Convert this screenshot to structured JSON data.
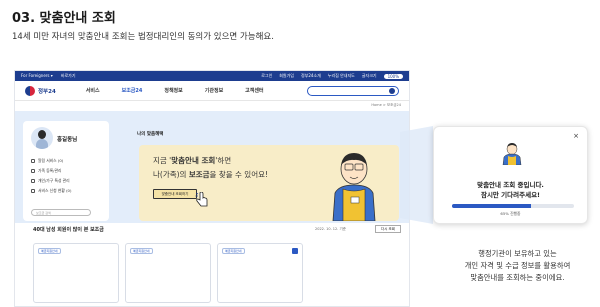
{
  "heading": "03. 맞춤안내 조회",
  "description": "14세 미만 자녀의 맞춤안내 조회는 법정대리인의 동의가 있으면 가능해요.",
  "site": {
    "topbar_left": [
      "For Foreigners ▾",
      "바로가기"
    ],
    "topbar_right": [
      "로그인",
      "회원가입",
      "정부24소개",
      "누리집 안내지도",
      "글자크기"
    ],
    "logo_text": "정부24",
    "nav": [
      "서비스",
      "보조금24",
      "정책정보",
      "기관정보",
      "고객센터"
    ],
    "active_nav_index": 1,
    "breadcrumb": "Home > 보조금24"
  },
  "profile": {
    "name": "홍길동님",
    "menu": [
      "알림 서비스 (0)",
      "가족 등록/관리",
      "개인/가구 특성 관리",
      "서비스 신청 현황 (0)"
    ],
    "search_placeholder": "보조금 검색"
  },
  "main": {
    "section_title": "나의 맞춤혜택",
    "banner_line1_pre": "지금 '",
    "banner_line1_bold": "맞춤안내 조회",
    "banner_line1_post": "'하면",
    "banner_line2_pre": "나(가족)의 ",
    "banner_line2_bold": "보조금",
    "banner_line2_post": "을 찾을 수 있어요!",
    "banner_button": "맞춤안내 조회하기"
  },
  "lower": {
    "title": "40대 남성 회원이 많이 본 보조금",
    "date": "2022. 10. 12. 기준",
    "button": "다시 조회",
    "cards": [
      {
        "tag": "예금지원안내"
      },
      {
        "tag": "예금지원안내"
      },
      {
        "tag": "예금지원안내"
      }
    ]
  },
  "modal": {
    "close": "×",
    "title1": "맞춤안내 조회 중입니다.",
    "title2": "잠시만 기다려주세요!",
    "progress": 0.65,
    "progress_text": "65% 진행중"
  },
  "caption": {
    "line1": "행정기관이 보유하고 있는",
    "line2": "개인 자격 및 수급 정보를 활용하여",
    "line3": "맞춤안내를 조회하는 중이에요."
  },
  "colors": {
    "primary": "#2b59c3",
    "topbar": "#1d3d8f",
    "banner": "#f8edc8",
    "content_bg": "#e3edfa"
  }
}
